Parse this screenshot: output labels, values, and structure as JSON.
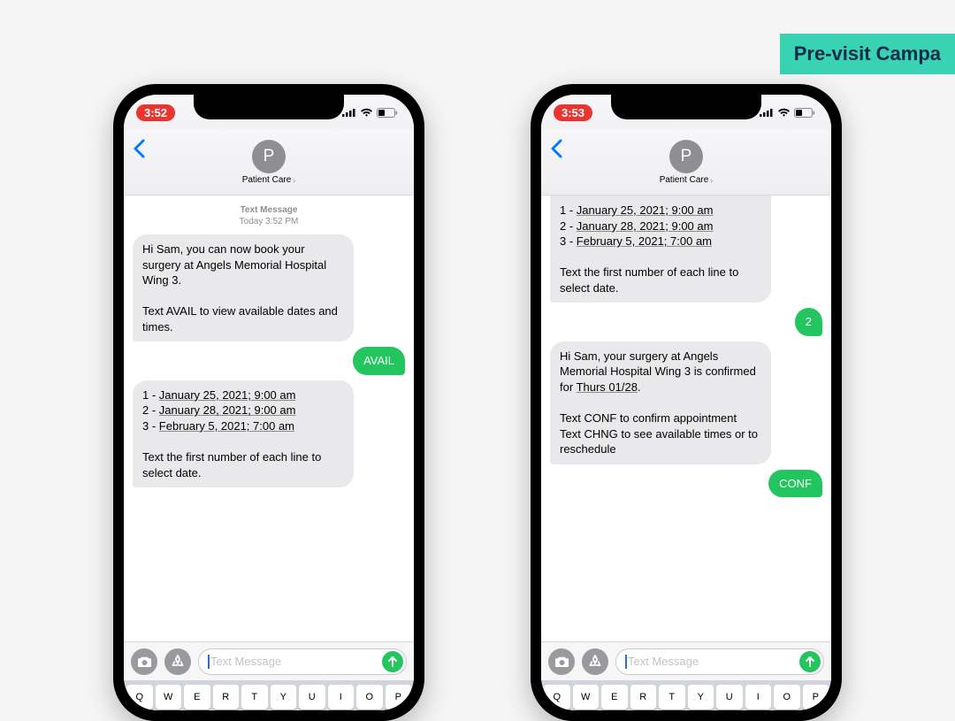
{
  "badge": {
    "text": "Pre-visit Campa"
  },
  "phones": [
    {
      "status": {
        "time": "3:52"
      },
      "nav": {
        "avatar_letter": "P",
        "contact_name": "Patient Care"
      },
      "timestamp": {
        "label": "Text Message",
        "time": "Today 3:52 PM"
      },
      "messages": [
        {
          "dir": "in",
          "text": "Hi Sam, you can now book your surgery at Angels Memorial Hospital Wing 3.\n\nText AVAIL to view available dates and times."
        },
        {
          "dir": "out",
          "text": "AVAIL"
        },
        {
          "dir": "in",
          "text": "1 - January 25, 2021; 9:00 am\n2 - January 28, 2021; 9:00 am\n3 - February 5, 2021; 7:00 am\n\nText the first number of each line to select date.",
          "underline_dates": true
        }
      ],
      "input": {
        "placeholder": "Text Message"
      },
      "keyboard_row": [
        "Q",
        "W",
        "E",
        "R",
        "T",
        "Y",
        "U",
        "I",
        "O",
        "P"
      ]
    },
    {
      "status": {
        "time": "3:53"
      },
      "nav": {
        "avatar_letter": "P",
        "contact_name": "Patient Care"
      },
      "messages": [
        {
          "dir": "in",
          "text": "1 - January 25, 2021; 9:00 am\n2 - January 28, 2021; 9:00 am\n3 - February 5, 2021; 7:00 am\n\nText the first number of each line to select date.",
          "underline_dates": true,
          "scrolled_top": true
        },
        {
          "dir": "out",
          "text": "2"
        },
        {
          "dir": "in",
          "text": "Hi Sam, your surgery at Angels Memorial Hospital Wing 3 is confirmed for Thurs 01/28.\n\nText CONF to confirm appointment\nText CHNG to see available times or to reschedule",
          "underline_token": "Thurs 01/28"
        },
        {
          "dir": "out",
          "text": "CONF"
        }
      ],
      "input": {
        "placeholder": "Text Message"
      },
      "keyboard_row": [
        "Q",
        "W",
        "E",
        "R",
        "T",
        "Y",
        "U",
        "I",
        "O",
        "P"
      ]
    }
  ]
}
